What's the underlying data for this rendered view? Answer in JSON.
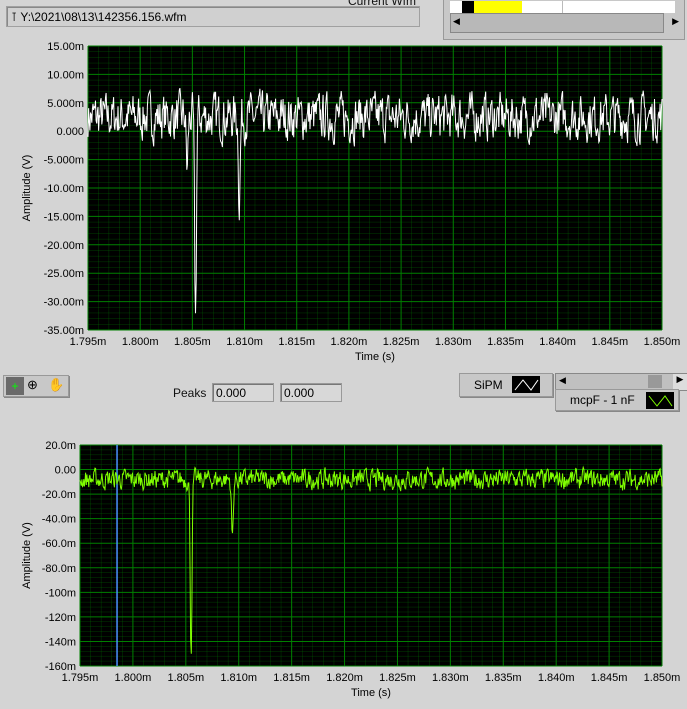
{
  "file_path": "Y:\\2021\\08\\13\\142356.156.wfm",
  "current_wfm_label": "Current Wfm",
  "peaks": {
    "label": "Peaks",
    "value1": "0.000",
    "value2": "0.000"
  },
  "legend": {
    "sipm": "SiPM",
    "mcpf": "mcpF - 1 nF"
  },
  "colors": {
    "top_trace": "#ffffff",
    "bottom_trace": "#80ff00",
    "grid": "#008000",
    "cursor": "#4a90ff"
  },
  "chart_data": [
    {
      "type": "line",
      "xlabel": "Time (s)",
      "ylabel": "Amplitude (V)",
      "xlim": [
        1.795,
        1.85
      ],
      "ylim": [
        -35,
        15
      ],
      "xticks": [
        "1.795m",
        "1.800m",
        "1.805m",
        "1.810m",
        "1.815m",
        "1.820m",
        "1.825m",
        "1.830m",
        "1.835m",
        "1.840m",
        "1.845m",
        "1.850m"
      ],
      "yticks": [
        "15.00m",
        "10.00m",
        "5.000m",
        "0.000",
        "-5.000m",
        "-10.00m",
        "-15.00m",
        "-20.00m",
        "-25.00m",
        "-30.00m",
        "-35.00m"
      ],
      "series": [
        {
          "name": "SiPM",
          "baseline": 2.5,
          "noise": 3.5,
          "peaks": [
            [
              1.8053,
              -33
            ],
            [
              1.8095,
              -12.5
            ],
            [
              1.8045,
              -7
            ]
          ]
        }
      ]
    },
    {
      "type": "line",
      "xlabel": "Time (s)",
      "ylabel": "Amplitude (V)",
      "xlim": [
        1.795,
        1.85
      ],
      "ylim": [
        -160,
        20
      ],
      "xticks": [
        "1.795m",
        "1.800m",
        "1.805m",
        "1.810m",
        "1.815m",
        "1.820m",
        "1.825m",
        "1.830m",
        "1.835m",
        "1.840m",
        "1.845m",
        "1.850m"
      ],
      "yticks": [
        "20.0m",
        "0.00",
        "-20.0m",
        "-40.0m",
        "-60.0m",
        "-80.0m",
        "-100m",
        "-120m",
        "-140m",
        "-160m"
      ],
      "cursor_x": 1.7985,
      "series": [
        {
          "name": "mcpF - 1 nF",
          "baseline": -8,
          "noise": 7,
          "peaks": [
            [
              1.8055,
              -148
            ],
            [
              1.8094,
              -56
            ]
          ]
        }
      ]
    }
  ]
}
